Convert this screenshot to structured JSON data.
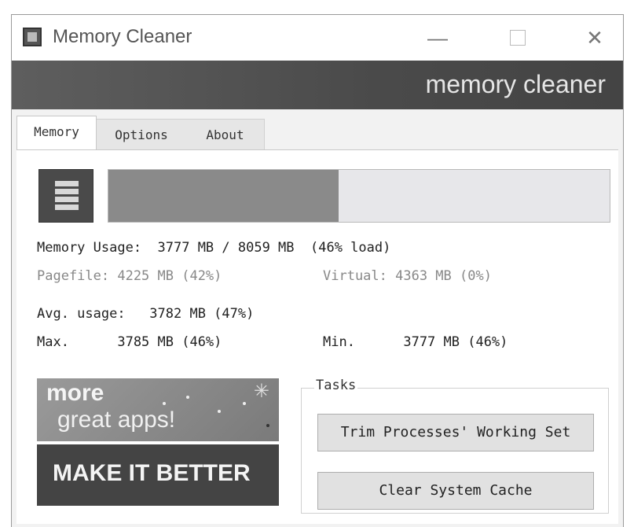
{
  "window": {
    "title": "Memory Cleaner",
    "controls": {
      "minimize": "—",
      "close": "✕"
    }
  },
  "banner": {
    "text": "memory cleaner"
  },
  "tabs": [
    {
      "label": "Memory",
      "active": true
    },
    {
      "label": "Options",
      "active": false
    },
    {
      "label": "About",
      "active": false
    }
  ],
  "memory": {
    "load_fraction": 0.46,
    "bar_fill_color": "#8a8a8a",
    "usage_line": "Memory Usage:  3777 MB / 8059 MB  (46% load)",
    "pagefile_line": "Pagefile: 4225 MB (42%)",
    "virtual_line": "Virtual: 4363 MB (0%)",
    "avg_line": "Avg. usage:   3782 MB (47%)",
    "max_line": "Max.      3785 MB (46%)",
    "min_line": "Min.      3777 MB (46%)"
  },
  "promo": {
    "line1": "more",
    "line2": "great apps!",
    "star_icon": "sparkle-icon",
    "make_better": "MAKE IT BETTER"
  },
  "tasks": {
    "legend": "Tasks",
    "trim_button": "Trim Processes' Working Set",
    "clear_button": "Clear System Cache"
  }
}
